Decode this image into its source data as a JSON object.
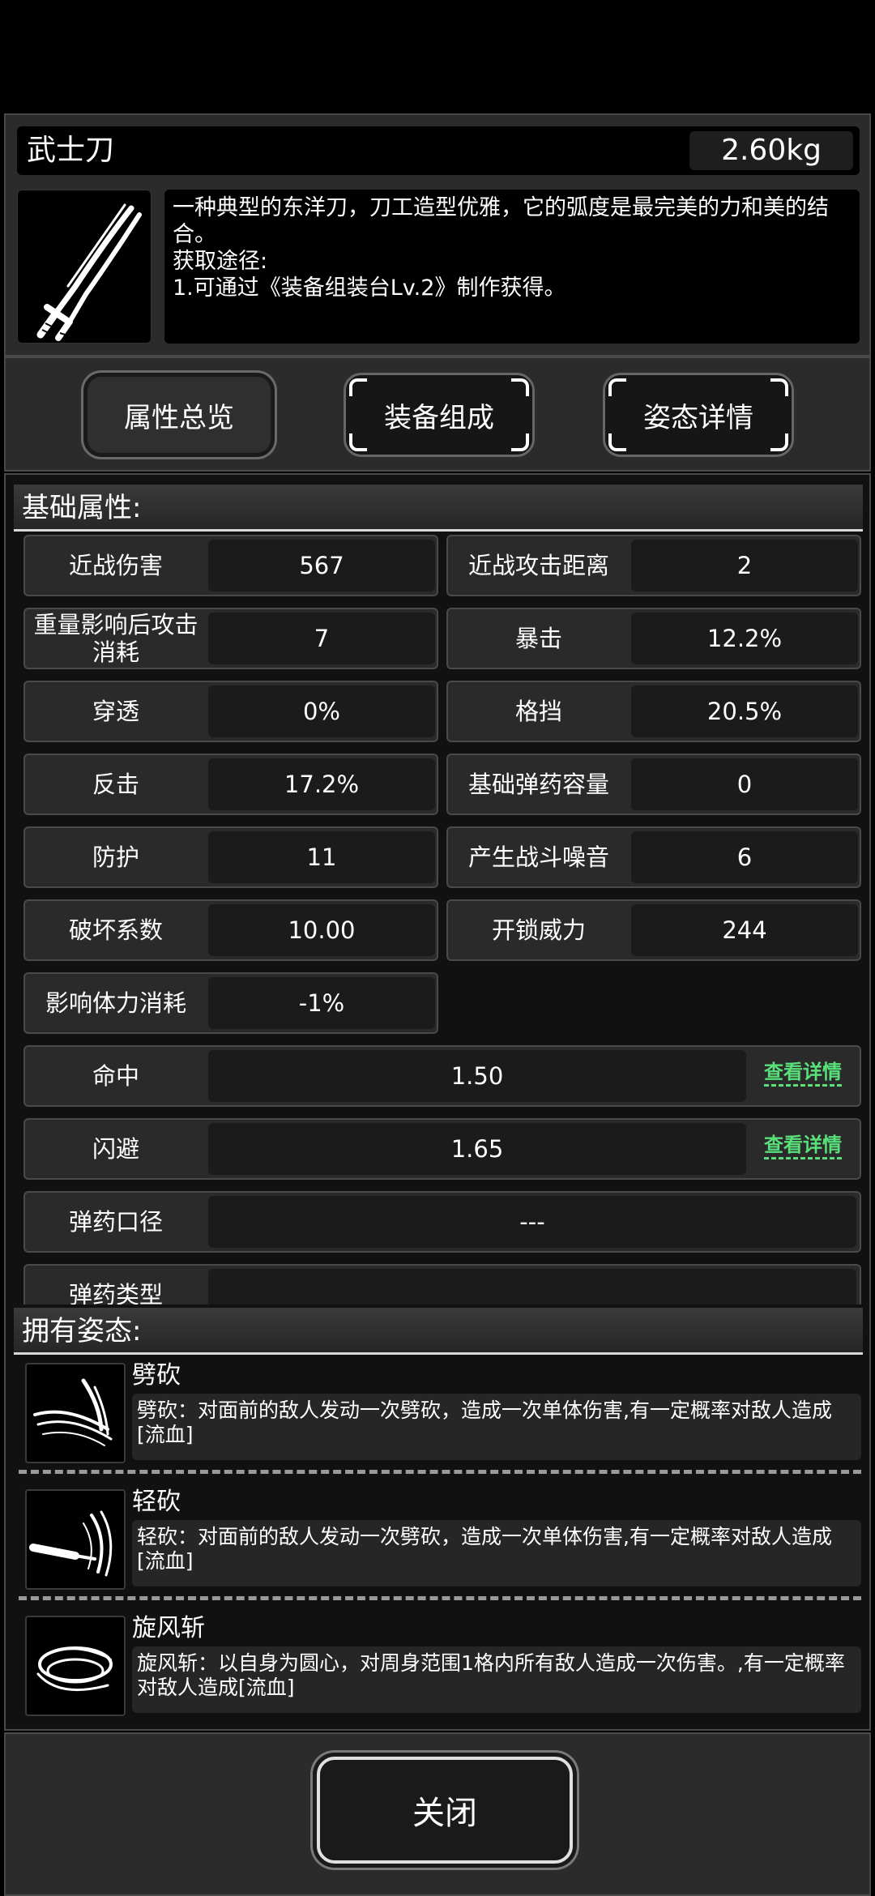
{
  "item": {
    "name": "武士刀",
    "weight": "2.60kg",
    "icon": "katana-icon",
    "description": "一种典型的东洋刀，刀工造型优雅，它的弧度是最完美的力和美的结合。\n获取途径:\n1.可通过《装备组装台Lv.2》制作获得。"
  },
  "tabs": [
    {
      "label": "属性总览",
      "active": true
    },
    {
      "label": "装备组成",
      "active": false
    },
    {
      "label": "姿态详情",
      "active": false
    }
  ],
  "base_attributes": {
    "title": "基础属性:",
    "pairs": [
      {
        "label": "近战伤害",
        "value": "567"
      },
      {
        "label": "近战攻击距离",
        "value": "2"
      },
      {
        "label": "重量影响后攻击消耗",
        "value": "7"
      },
      {
        "label": "暴击",
        "value": "12.2%"
      },
      {
        "label": "穿透",
        "value": "0%"
      },
      {
        "label": "格挡",
        "value": "20.5%"
      },
      {
        "label": "反击",
        "value": "17.2%"
      },
      {
        "label": "基础弹药容量",
        "value": "0"
      },
      {
        "label": "防护",
        "value": "11"
      },
      {
        "label": "产生战斗噪音",
        "value": "6"
      },
      {
        "label": "破坏系数",
        "value": "10.00"
      },
      {
        "label": "开锁威力",
        "value": "244"
      },
      {
        "label": "影响体力消耗",
        "value": "-1%"
      }
    ],
    "wide": [
      {
        "label": "命中",
        "value": "1.50",
        "link": "查看详情"
      },
      {
        "label": "闪避",
        "value": "1.65",
        "link": "查看详情"
      },
      {
        "label": "弹药口径",
        "value": "---"
      },
      {
        "label": "弹药类型",
        "value": ""
      }
    ]
  },
  "stances": {
    "title": "拥有姿态:",
    "items": [
      {
        "name": "劈砍",
        "icon": "slash-icon",
        "desc": "劈砍：对面前的敌人发动一次劈砍，造成一次单体伤害,有一定概率对敌人造成[流血]"
      },
      {
        "name": "轻砍",
        "icon": "light-slash-icon",
        "desc": "轻砍：对面前的敌人发动一次劈砍，造成一次单体伤害,有一定概率对敌人造成[流血]"
      },
      {
        "name": "旋风斩",
        "icon": "whirlwind-icon",
        "desc": "旋风斩：以自身为圆心，对周身范围1格内所有敌人造成一次伤害。,有一定概率对敌人造成[流血]"
      }
    ]
  },
  "close_label": "关闭"
}
